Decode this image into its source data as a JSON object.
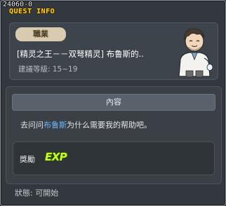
{
  "window": {
    "quest_id": "24060-0",
    "title": "QUEST INFO"
  },
  "header": {
    "job_badge": "職業",
    "quest_name": "[精灵之王－－双弩精灵] 布鲁斯的..",
    "recommend_level": "建議等級: 15~19",
    "portrait_icon": "npc-portrait-icon"
  },
  "content": {
    "section_title": "內容",
    "description_prefix": "去问问",
    "npc_name": "布鲁斯",
    "description_suffix": "为什么需要我的帮助吧。",
    "reward_label": "獎勵",
    "reward_icon_text": "EXP"
  },
  "status": {
    "text": "狀態: 可開始"
  },
  "colors": {
    "title": "#ffd21e",
    "npc_link": "#6cb8ff",
    "exp": "#cdfb2a"
  }
}
